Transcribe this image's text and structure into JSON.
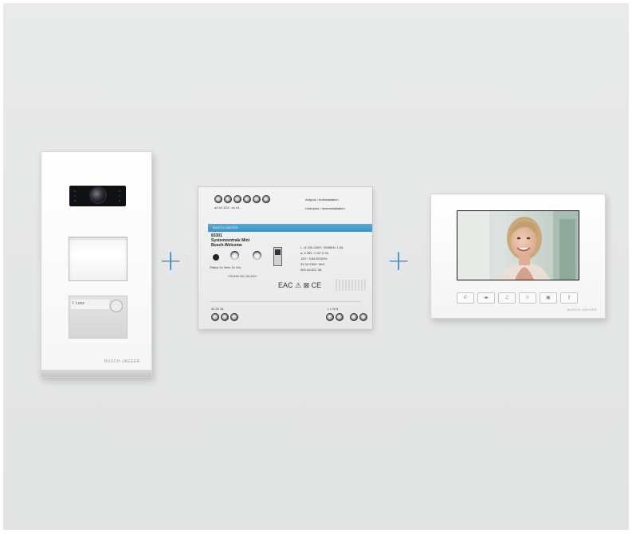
{
  "door_station": {
    "name_label": "f. Lenz",
    "brand": "BUSCH-JAEGER"
  },
  "plus_sign": "+",
  "power_supply": {
    "terminal_labels_top": "a2  b2   12V~   a1  b1",
    "install_surface": "Aufputz / Aufinstallation",
    "install_flush": "Unterputz / Inneninstallation",
    "bar_text": "BUSCH-JAEGER",
    "model_number": "83301",
    "model_name": "Systemzentrale Mini",
    "brand_line": "Busch-Welcome",
    "dial_labels": "Status   1s   3min 1s   10s",
    "voltage_labels": "~23-34V   DC-34,12V~",
    "spec_line1": "L, N   100-240V~ 50/60Hz 1,5A",
    "spec_line2": "a, b   28V    +/-2V 0,7A",
    "spec_line3": "12V~   0,8A  ED30%",
    "spec_line4": "33 34   230V~3AX",
    "spec_line5": "30V AC/DC 3A",
    "cert_marks": "EAC  ⚠  ⊠  CE",
    "bottom_left_labels": "33   32   34",
    "bottom_right_labels": "L   L     N   N"
  },
  "monitor": {
    "brand": "BUSCH-JAEGER",
    "buttons": [
      "✆",
      "◂▸",
      "♫",
      "☼",
      "▣",
      "⚷"
    ]
  }
}
